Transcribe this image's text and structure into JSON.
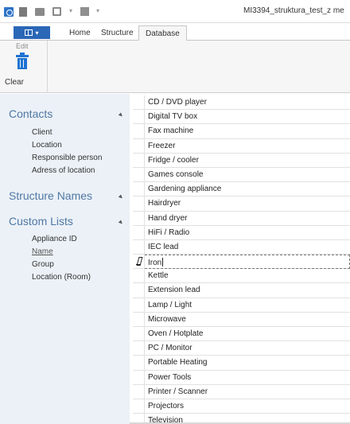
{
  "window": {
    "title": "MI3394_struktura_test_z me",
    "quick_access": [
      "app-icon",
      "new-document-icon",
      "open-folder-icon",
      "save-icon",
      "dropdown-caret-icon",
      "print-icon",
      "dropdown-caret-icon"
    ]
  },
  "ribbon": {
    "file_menu": {
      "icon": "grid-icon",
      "caret": "▾"
    },
    "tabs": [
      {
        "label": "Home",
        "active": false
      },
      {
        "label": "Structure",
        "active": false
      },
      {
        "label": "Database",
        "active": true
      }
    ],
    "edit_group": {
      "label": "Edit",
      "clear_button": {
        "label": "Clear",
        "icon": "trash-icon"
      }
    }
  },
  "sidebar": {
    "sections": [
      {
        "title": "Contacts",
        "items": [
          "Client",
          "Location",
          "Responsible person",
          "Adress of location"
        ]
      },
      {
        "title": "Structure Names",
        "items": []
      },
      {
        "title": "Custom Lists",
        "items": [
          "Appliance ID",
          "Name",
          "Group",
          "Location (Room)"
        ],
        "selected": "Name"
      }
    ]
  },
  "list": {
    "rows": [
      "CD / DVD player",
      "Digital TV box",
      "Fax machine",
      "Freezer",
      "Fridge / cooler",
      "Games console",
      "Gardening appliance",
      "Hairdryer",
      "Hand dryer",
      "HiFi / Radio",
      "IEC lead",
      "Iron",
      "Kettle",
      "Extension lead",
      "Lamp / Light",
      "Microwave",
      "Oven / Hotplate",
      "PC / Monitor",
      "Portable Heating",
      "Power Tools",
      "Printer / Scanner",
      "Projectors",
      "Television"
    ],
    "editing_row": 11
  },
  "colors": {
    "accent": "#2a67b7",
    "sidebar_bg": "#ebf1f7",
    "section_heading": "#5077a3",
    "trash_icon": "#1e73d2"
  }
}
